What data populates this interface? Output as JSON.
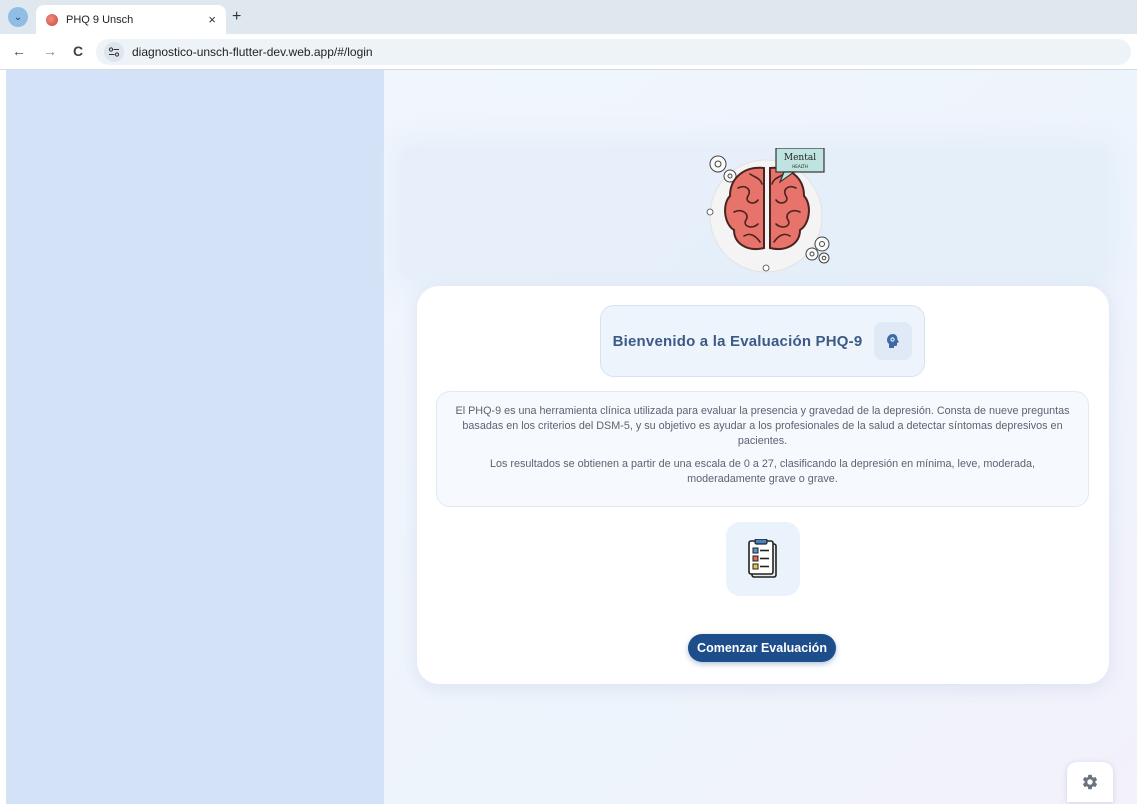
{
  "browser": {
    "tab_title": "PHQ 9 Unsch",
    "tab_close_glyph": "×",
    "new_tab_glyph": "+",
    "url": "diagnostico-unsch-flutter-dev.web.app/#/login",
    "back_glyph": "←",
    "forward_glyph": "→",
    "reload_glyph": "C",
    "tab_search_glyph": "⌄"
  },
  "hero": {
    "bubble_text": "Mental",
    "bubble_subtext": "HEALTH"
  },
  "card": {
    "welcome_title": "Bienvenido a la Evaluación PHQ-9",
    "description_p1": "El PHQ-9 es una herramienta clínica utilizada para evaluar la presencia y gravedad de la depresión. Consta de nueve preguntas basadas en los criterios del DSM-5, y su objetivo es ayudar a los profesionales de la salud a detectar síntomas depresivos en pacientes.",
    "description_p2": "Los resultados se obtienen a partir de una escala de 0 a 27, clasificando la depresión en mínima, leve, moderada, moderadamente grave o grave.",
    "start_button_label": "Comenzar Evaluación"
  },
  "icons": {
    "brain_badge": "brain-icon",
    "clipboard": "clipboard-checklist-icon",
    "settings": "gear-icon"
  },
  "colors": {
    "primary": "#1e4d8c",
    "left_panel": "#d3e2f7",
    "title": "#3d5a86"
  }
}
